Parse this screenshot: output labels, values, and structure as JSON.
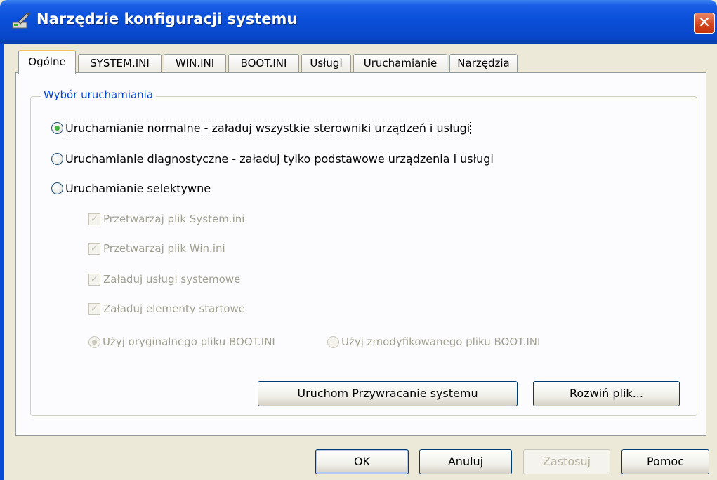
{
  "window": {
    "title": "Narzędzie konfiguracji systemu",
    "close_glyph": "✕"
  },
  "tabs": [
    {
      "label": "Ogólne"
    },
    {
      "label": "SYSTEM.INI"
    },
    {
      "label": "WIN.INI"
    },
    {
      "label": "BOOT.INI"
    },
    {
      "label": "Usługi"
    },
    {
      "label": "Uruchamianie"
    },
    {
      "label": "Narzędzia"
    }
  ],
  "group": {
    "label": "Wybór uruchamiania",
    "radios": [
      {
        "label": "Uruchamianie normalne - załaduj wszystkie sterowniki urządzeń i usługi",
        "checked": true
      },
      {
        "label": "Uruchamianie diagnostyczne - załaduj tylko podstawowe urządzenia i usługi",
        "checked": false
      },
      {
        "label": "Uruchamianie selektywne",
        "checked": false
      }
    ],
    "checkboxes": [
      {
        "label": "Przetwarzaj plik System.ini",
        "checked": true
      },
      {
        "label": "Przetwarzaj plik Win.ini",
        "checked": true
      },
      {
        "label": "Załaduj usługi systemowe",
        "checked": true
      },
      {
        "label": "Załaduj elementy startowe",
        "checked": true
      }
    ],
    "boot_options": [
      {
        "label": "Użyj oryginalnego pliku BOOT.INI",
        "checked": true
      },
      {
        "label": "Użyj zmodyfikowanego pliku BOOT.INI",
        "checked": false
      }
    ],
    "buttons": {
      "restore": "Uruchom Przywracanie systemu",
      "expand": "Rozwiń plik..."
    }
  },
  "footer": {
    "ok": "OK",
    "cancel": "Anuluj",
    "apply": "Zastosuj",
    "help": "Pomoc"
  },
  "check_glyph": "✓"
}
